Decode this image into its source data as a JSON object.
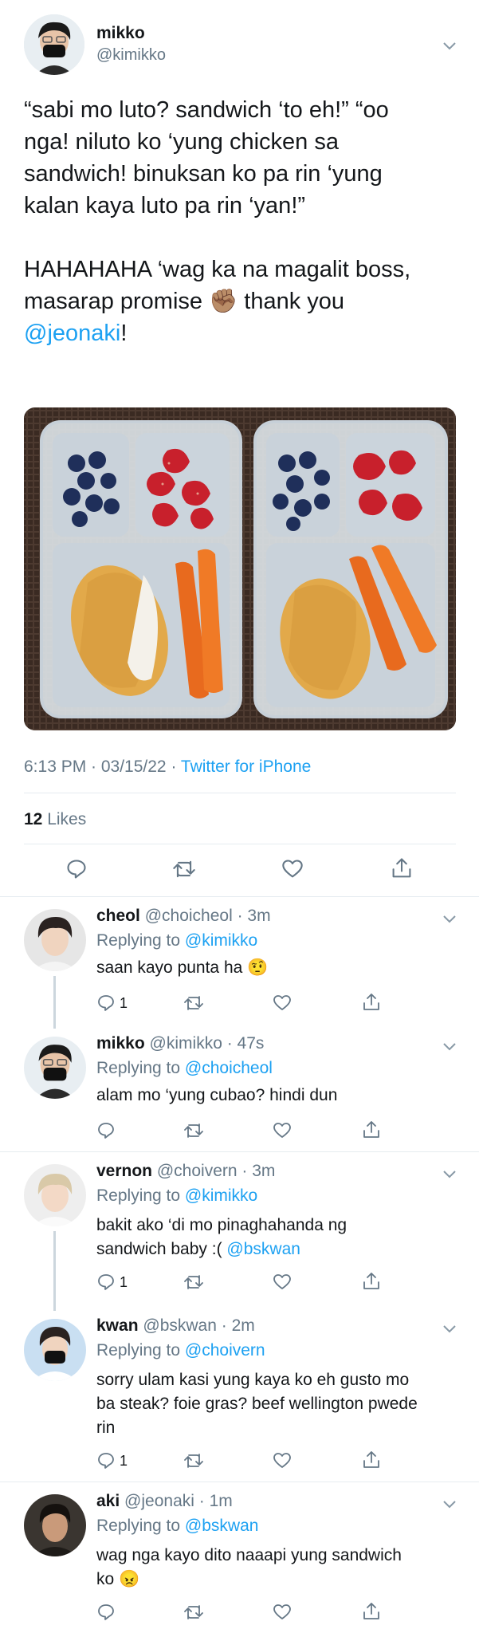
{
  "main_tweet": {
    "author_name": "mikko",
    "author_handle": "@kimikko",
    "text_line1": "“sabi mo luto? sandwich ‘to eh!” “oo",
    "text_line2": "nga! niluto ko ‘yung chicken sa",
    "text_line3": "sandwich! binuksan ko pa rin ‘yung",
    "text_line4": "kalan kaya luto pa rin ‘yan!”",
    "text_line5_a": "HAHAHAHA ‘wag ka na magalit boss,",
    "text_line6_a": "masarap promise",
    "text_line6_emoji": "✊🏽",
    "text_line6_b": "thank you",
    "mention": "@jeonaki",
    "mention_suffix": "!",
    "timestamp": "6:13 PM · 03/15/22 · ",
    "source": "Twitter for iPhone",
    "likes_count": "12",
    "likes_label": "Likes"
  },
  "replies": [
    {
      "name": "cheol",
      "handle": "@choicheol",
      "time": " · 3m",
      "replying_prefix": "Replying to ",
      "replying_to": "@kimikko",
      "text": "saan kayo punta ha",
      "emoji": "🤨",
      "reply_count": "1"
    },
    {
      "name": "mikko",
      "handle": "@kimikko",
      "time": " · 47s",
      "replying_prefix": "Replying to ",
      "replying_to": "@choicheol",
      "text": "alam mo ‘yung cubao? hindi dun",
      "reply_count": ""
    },
    {
      "name": "vernon",
      "handle": "@choivern",
      "time": " · 3m",
      "replying_prefix": "Replying to ",
      "replying_to": "@kimikko",
      "text_line1": "bakit ako ‘di mo pinaghahanda ng",
      "text_line2": "sandwich baby :( ",
      "mention": "@bskwan",
      "reply_count": "1"
    },
    {
      "name": "kwan",
      "handle": "@bskwan",
      "time": " · 2m",
      "replying_prefix": "Replying to ",
      "replying_to": "@choivern",
      "text_line1": "sorry ulam kasi yung kaya ko eh gusto mo",
      "text_line2": "ba steak? foie gras? beef wellington pwede",
      "text_line3": "rin",
      "reply_count": "1"
    },
    {
      "name": "aki",
      "handle": "@jeonaki",
      "time": " · 1m",
      "replying_prefix": "Replying to ",
      "replying_to": "@bskwan",
      "text_line1": "wag nga kayo dito naaapi yung sandwich",
      "text_line2": "ko",
      "emoji": "😠",
      "reply_count": ""
    }
  ],
  "colors": {
    "link": "#1da1f2",
    "muted": "#657786",
    "text": "#14171a",
    "divider": "#e6ecf0"
  },
  "icons": [
    "chevron-down-icon",
    "reply-icon",
    "retweet-icon",
    "like-icon",
    "share-icon"
  ]
}
